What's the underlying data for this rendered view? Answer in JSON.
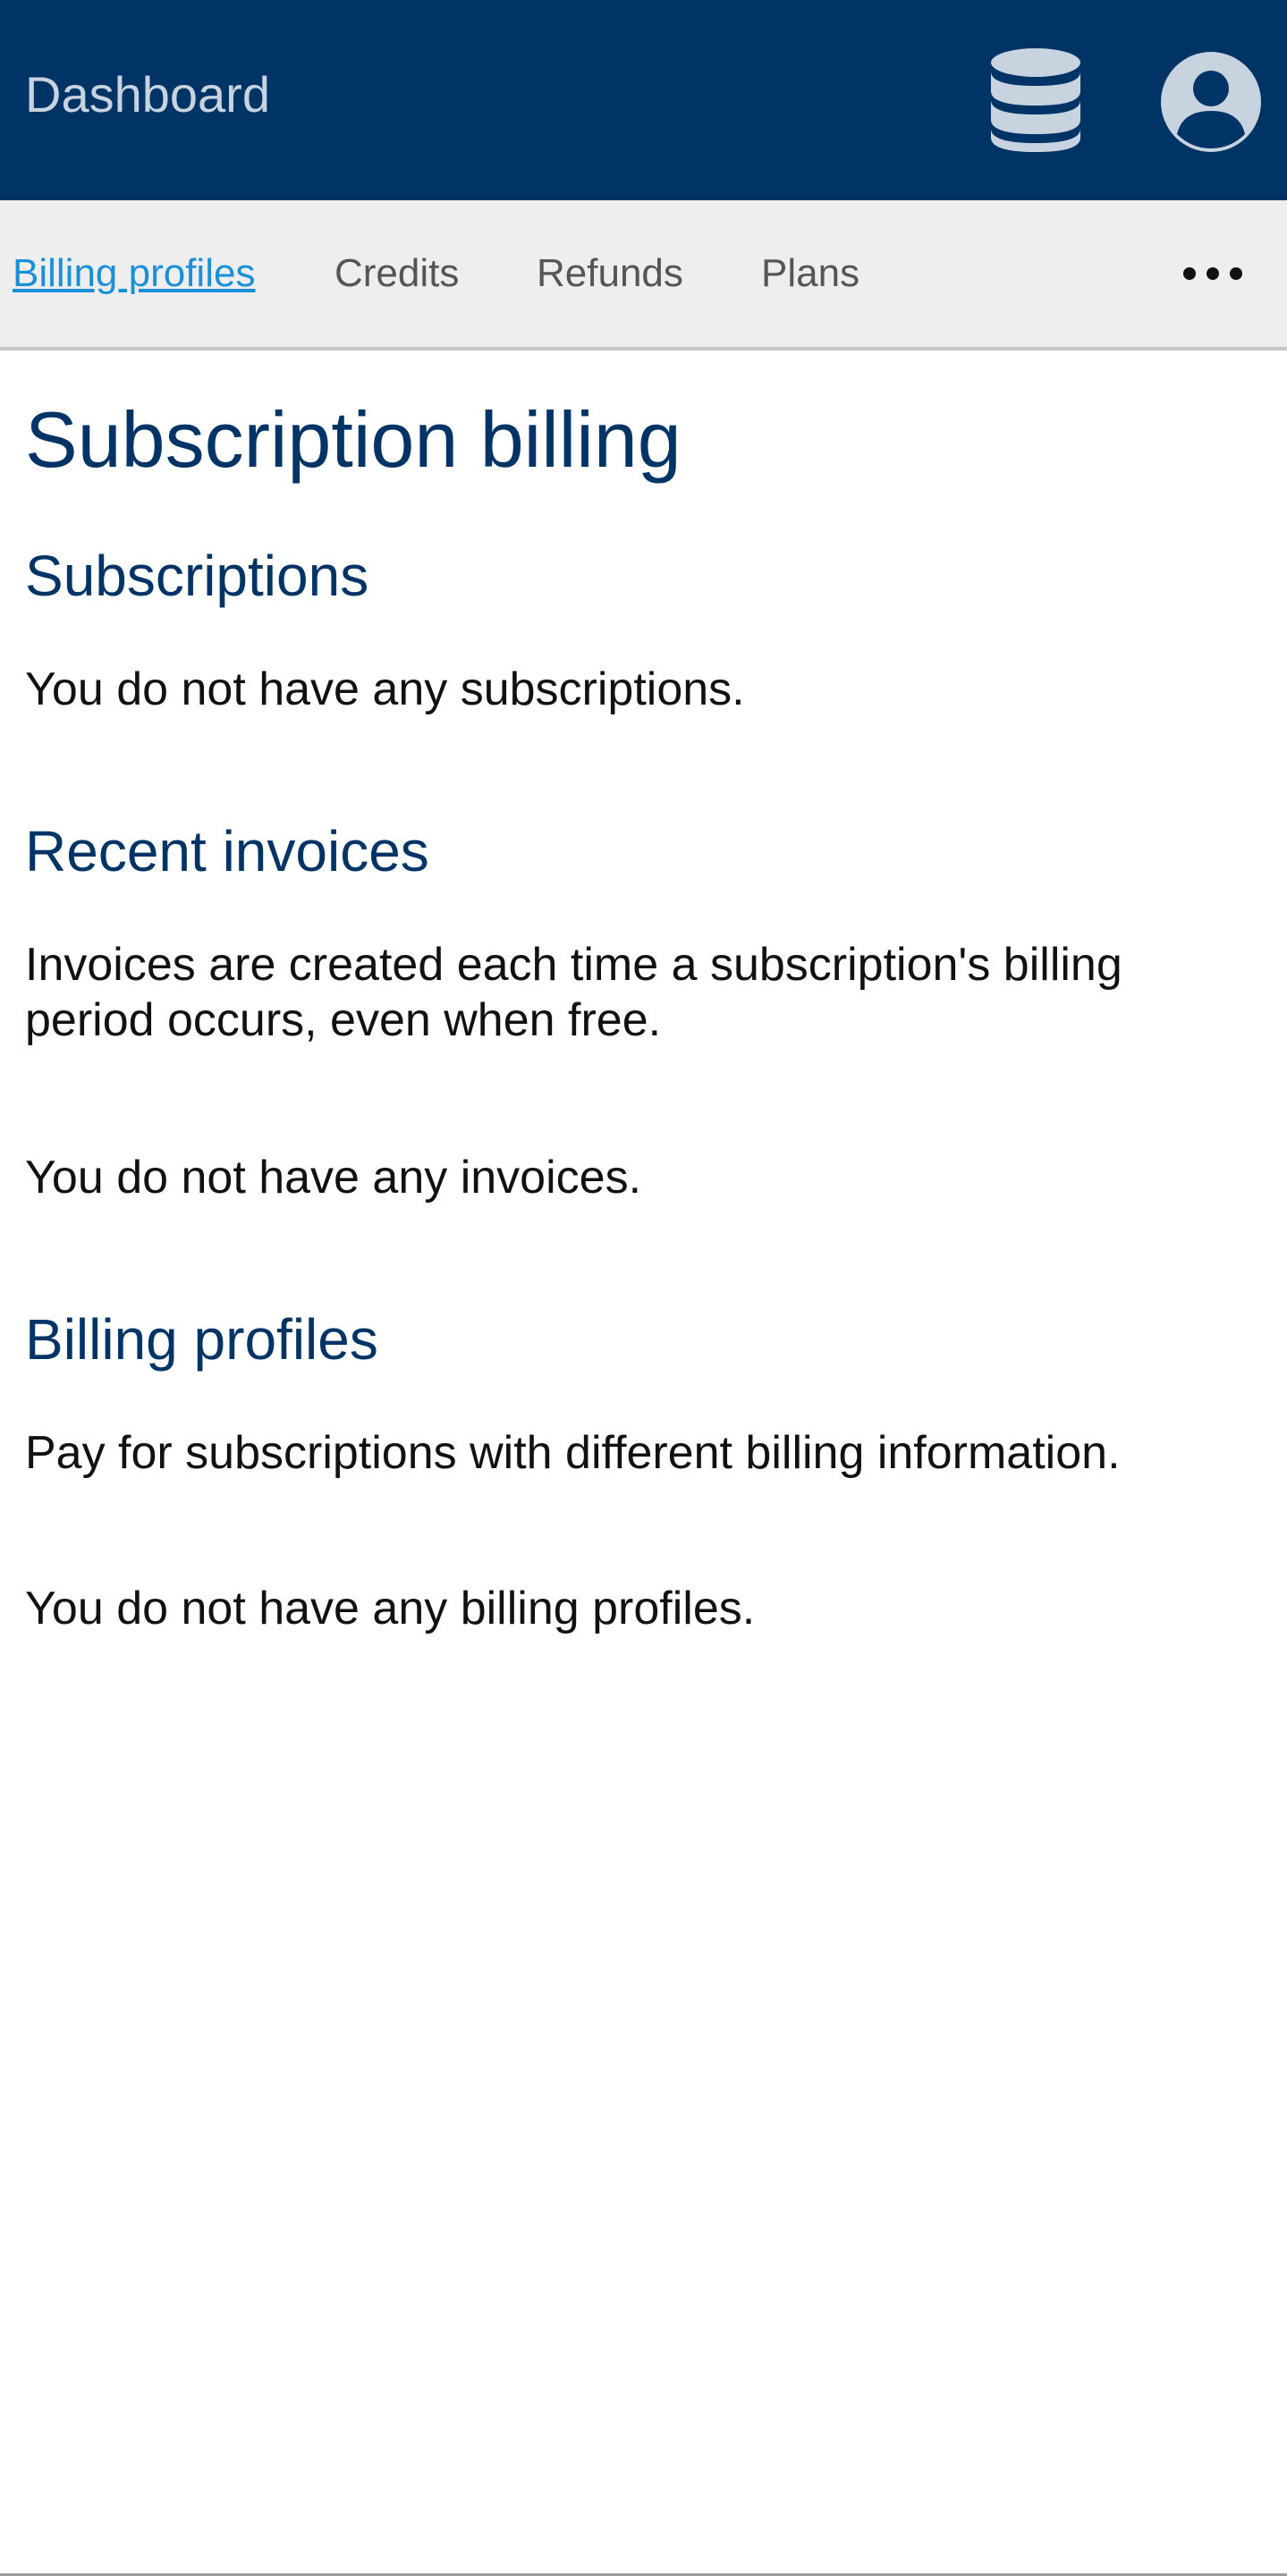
{
  "header": {
    "brand": "Dashboard",
    "database_icon": "database-icon",
    "user_icon": "user-circle-icon",
    "background_color": "#003366"
  },
  "subnav": {
    "items": [
      {
        "label": "Billing profiles",
        "active": true
      },
      {
        "label": "Credits",
        "active": false
      },
      {
        "label": "Refunds",
        "active": false
      },
      {
        "label": "Plans",
        "active": false
      }
    ],
    "more_icon": "ellipsis-icon",
    "active_color": "#1a90d9"
  },
  "main": {
    "title": "Subscription billing",
    "sections": [
      {
        "heading": "Subscriptions",
        "paragraphs": [
          "You do not have any subscriptions."
        ]
      },
      {
        "heading": "Recent invoices",
        "paragraphs": [
          "Invoices are created each time a subscription's billing period occurs, even when free.",
          "You do not have any invoices."
        ]
      },
      {
        "heading": "Billing profiles",
        "paragraphs": [
          "Pay for subscriptions with different billing information.",
          "You do not have any billing profiles."
        ]
      }
    ]
  }
}
